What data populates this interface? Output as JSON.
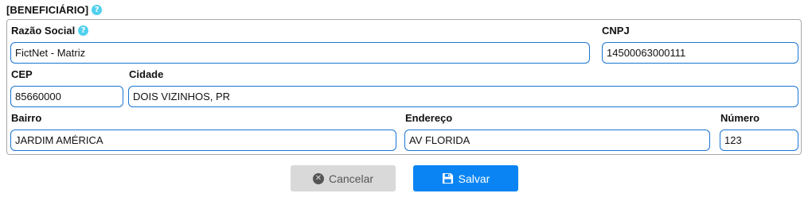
{
  "section": {
    "title": "[BENEFICIÁRIO]",
    "help_icon": "?"
  },
  "fields": {
    "razao_social": {
      "label": "Razão Social",
      "value": "FictNet - Matriz",
      "help_icon": "?"
    },
    "cnpj": {
      "label": "CNPJ",
      "value": "14500063000111"
    },
    "cep": {
      "label": "CEP",
      "value": "85660000"
    },
    "cidade": {
      "label": "Cidade",
      "value": "DOIS VIZINHOS, PR"
    },
    "bairro": {
      "label": "Bairro",
      "value": "JARDIM AMÉRICA"
    },
    "endereco": {
      "label": "Endereço",
      "value": "AV FLORIDA"
    },
    "numero": {
      "label": "Número",
      "value": "123"
    }
  },
  "buttons": {
    "cancel": {
      "label": "Cancelar",
      "icon": "x-circle-icon"
    },
    "save": {
      "label": "Salvar",
      "icon": "floppy-disk-icon"
    }
  },
  "colors": {
    "input_border": "#1a75d2",
    "help_icon": "#4fd0ee",
    "save_button": "#0a84f3",
    "cancel_button": "#d9d9d9"
  }
}
